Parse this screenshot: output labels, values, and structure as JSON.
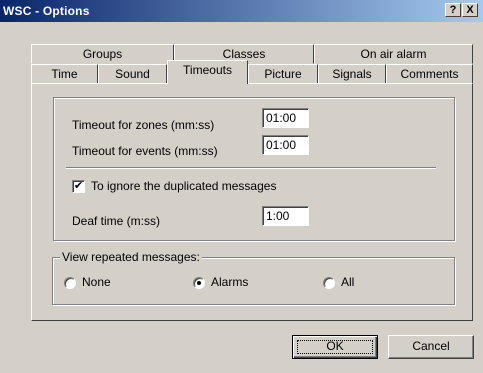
{
  "window": {
    "title": "WSC - Options",
    "help_label": "?",
    "close_label": "X"
  },
  "tabs": {
    "row_back": [
      "Groups",
      "Classes",
      "On air alarm"
    ],
    "row_front": [
      "Time",
      "Sound",
      "Timeouts",
      "Picture",
      "Signals",
      "Comments"
    ],
    "active": "Timeouts"
  },
  "timeouts": {
    "zones_label": "Timeout for zones (mm:ss)",
    "zones_value": "01:00",
    "events_label": "Timeout for events (mm:ss)",
    "events_value": "01:00",
    "ignore_duplicates_label": "To ignore the duplicated messages",
    "ignore_duplicates_checked": true,
    "check_mark": "✔",
    "deaf_time_label": "Deaf time (m:ss)",
    "deaf_time_value": "1:00"
  },
  "view_repeated": {
    "legend": "View repeated messages:",
    "options": [
      "None",
      "Alarms",
      "All"
    ],
    "selected": "Alarms"
  },
  "buttons": {
    "ok_label": "OK",
    "cancel_label": "Cancel"
  },
  "colors": {
    "titlebar_start": "#0a246a",
    "titlebar_end": "#a6caf0",
    "face": "#d4d0c8"
  }
}
